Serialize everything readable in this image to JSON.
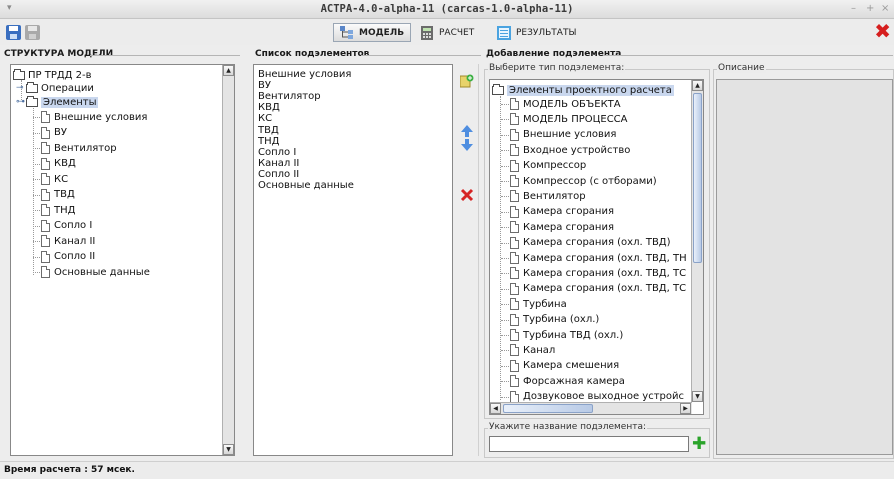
{
  "window": {
    "title": "АСТРА-4.0-alpha-11 (carcas-1.0-alpha-11)",
    "menu_glyph": "▾",
    "controls": [
      "–",
      "+",
      "×"
    ]
  },
  "toolbar": {
    "icons": [
      "save-icon",
      "save-disabled-icon"
    ],
    "tabs": [
      {
        "label": "МОДЕЛЬ",
        "icon": "model-icon",
        "active": true
      },
      {
        "label": "РАСЧЕТ",
        "icon": "calculator-icon",
        "active": false
      },
      {
        "label": "РЕЗУЛЬТАТЫ",
        "icon": "results-icon",
        "active": false
      }
    ],
    "close_glyph": "✖",
    "close_color": "#d61e1e"
  },
  "structure": {
    "title": "СТРУКТУРА МОДЕЛИ",
    "root": "ПР ТРДД 2-в",
    "operations": "Операции",
    "elements": "Элементы",
    "children": [
      "Внешние условия",
      "ВУ",
      "Вентилятор",
      "КВД",
      "КС",
      "ТВД",
      "ТНД",
      "Сопло I",
      "Канал II",
      "Сопло II",
      "Основные данные"
    ]
  },
  "sublist": {
    "title": "Список подэлементов",
    "items": [
      "Внешние условия",
      "ВУ",
      "Вентилятор",
      "КВД",
      "КС",
      "ТВД",
      "ТНД",
      "Сопло I",
      "Канал II",
      "Сопло II",
      "Основные данные"
    ],
    "side_icons": [
      "add-icon",
      "arrow-up-icon",
      "arrow-down-icon",
      "delete-icon"
    ]
  },
  "add": {
    "title": "Добавление подэлемента",
    "type_label": "Выберите тип подэлемента:",
    "description_label": "Описание",
    "root": "Элементы проектного расчета",
    "types": [
      "МОДЕЛЬ ОБЪЕКТА",
      "МОДЕЛЬ ПРОЦЕССА",
      "Внешние условия",
      "Входное устройство",
      "Компрессор",
      "Компрессор (с отборами)",
      "Вентилятор",
      "Камера сгорания",
      "Камера сгорания",
      "Камера сгорания (охл. ТВД)",
      "Камера сгорания (охл. ТВД, ТН",
      "Камера сгорания (охл. ТВД, ТС",
      "Камера сгорания (охл. ТВД, ТС",
      "Турбина",
      "Турбина (охл.)",
      "Турбина ТВД (охл.)",
      "Канал",
      "Камера смешения",
      "Форсажная камера",
      "Дозвуковое выходное устройс"
    ],
    "name_label": "Укажите название подэлемента:",
    "name_value": "",
    "add_glyph": "✚"
  },
  "status": {
    "text": "Время расчета : 57 мсек."
  }
}
